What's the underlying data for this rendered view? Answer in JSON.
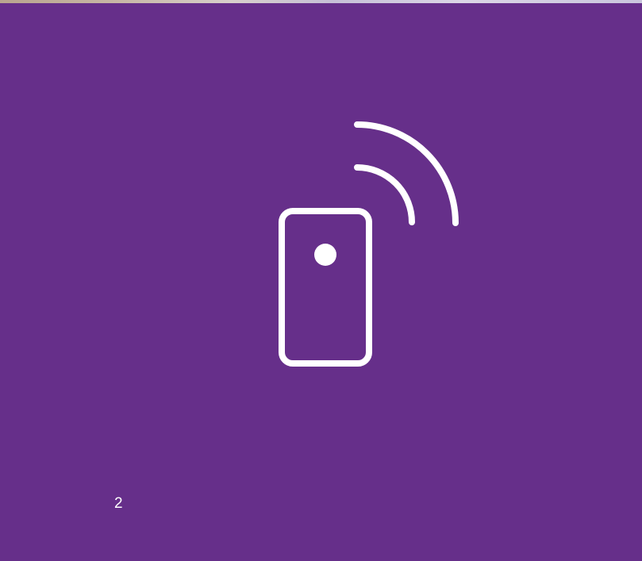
{
  "colors": {
    "background": "#662f8a",
    "foreground": "#ffffff",
    "top_strip": "#cfc5c9"
  },
  "illustration": {
    "icon": "remote-signal-icon"
  },
  "footer": {
    "page_number": "2"
  }
}
